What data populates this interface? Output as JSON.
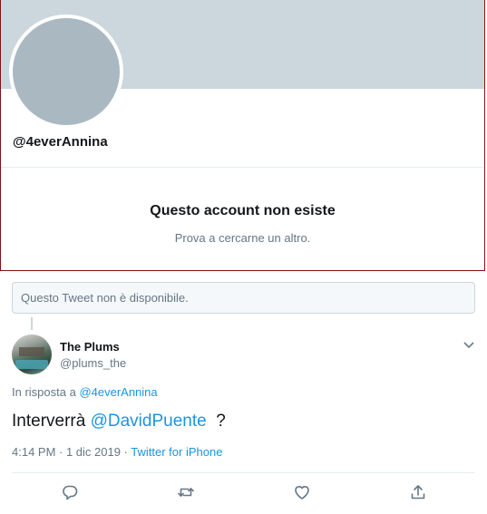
{
  "profile": {
    "handle": "@4everAnnina",
    "message_title": "Questo account non esiste",
    "message_subtitle": "Prova a cercarne un altro."
  },
  "unavailable_notice": "Questo Tweet non è disponibile.",
  "tweet": {
    "author_name": "The Plums",
    "author_handle": "@plums_the",
    "reply_prefix": "In risposta a ",
    "reply_mention": "@4everAnnina",
    "text_before": "Interverrà ",
    "text_mention": "@DavidPuente",
    "text_after": "  ?",
    "time_date": "4:14 PM · 1 dic 2019 · ",
    "source": "Twitter for iPhone"
  },
  "actions": [
    {
      "icon": "reply-icon"
    },
    {
      "icon": "retweet-icon"
    },
    {
      "icon": "like-icon"
    },
    {
      "icon": "share-icon"
    }
  ],
  "colors": {
    "link": "#1b95e0",
    "secondary_text": "#657786",
    "banner": "#ccd6dd",
    "avatar_placeholder": "#aab8c2",
    "card_border": "#7f1416"
  }
}
